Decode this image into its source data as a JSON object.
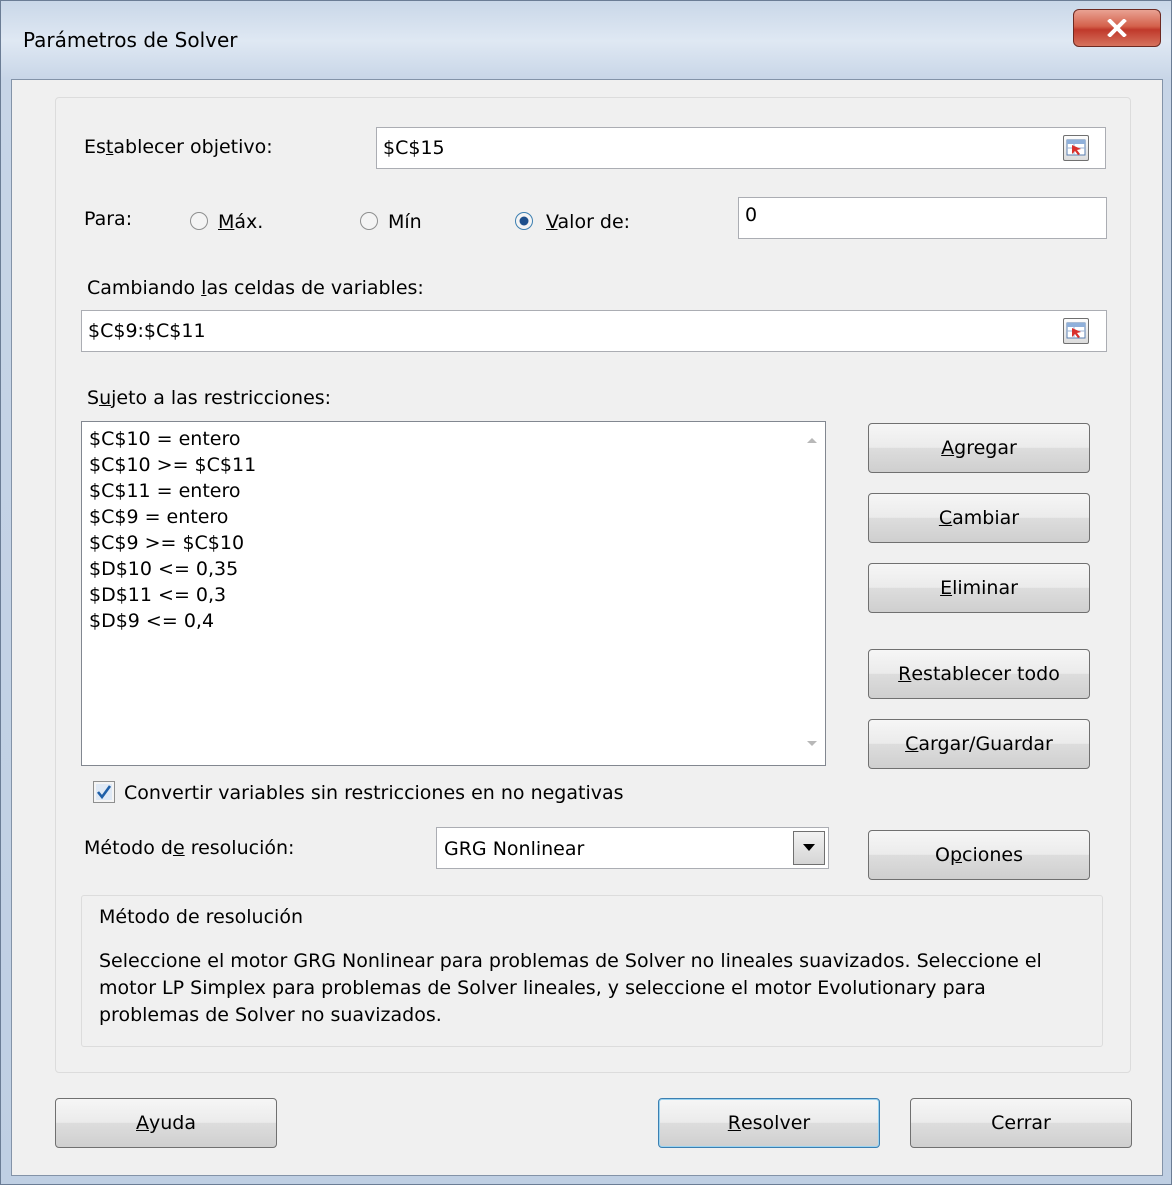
{
  "window": {
    "title": "Parámetros de Solver",
    "close_label": "X"
  },
  "objective": {
    "label_pre": "Es",
    "label_key": "t",
    "label_post": "ablecer objetivo:",
    "value": "$C$15"
  },
  "para": {
    "label": "Para:",
    "options": [
      {
        "pre": "",
        "key": "M",
        "post": "áx.",
        "selected": false
      },
      {
        "pre": "Mín",
        "key": "",
        "post": "",
        "selected": false
      },
      {
        "pre": "",
        "key": "V",
        "post": "alor de:",
        "selected": true
      }
    ],
    "value": "0"
  },
  "variables": {
    "label_pre": "Cambiando ",
    "label_key": "l",
    "label_post": "as celdas de variables:",
    "value": "$C$9:$C$11"
  },
  "constraints": {
    "label_pre": "S",
    "label_key": "u",
    "label_post": "jeto a las restricciones:",
    "items": [
      "$C$10 = entero",
      "$C$10 >= $C$11",
      "$C$11 = entero",
      "$C$9 = entero",
      "$C$9 >= $C$10",
      "$D$10 <= 0,35",
      "$D$11 <= 0,3",
      "$D$9 <= 0,4"
    ]
  },
  "side_buttons": {
    "add": {
      "key": "A",
      "rest": "gregar"
    },
    "change": {
      "key": "C",
      "rest": "ambiar"
    },
    "delete": {
      "key": "E",
      "rest": "liminar"
    },
    "reset": {
      "key": "R",
      "rest": "establecer todo"
    },
    "load": {
      "key": "C",
      "rest": "argar/Guardar"
    },
    "options": {
      "pre": "O",
      "key": "p",
      "rest": "ciones"
    }
  },
  "nonnegative": {
    "label": "Convertir variables sin restricciones en no negativas",
    "checked": true
  },
  "method": {
    "label_pre": "Método d",
    "label_key": "e",
    "label_post": " resolución:",
    "selected": "GRG Nonlinear"
  },
  "info": {
    "title": "Método de resolución",
    "body": "Seleccione el motor GRG Nonlinear para problemas de Solver no lineales suavizados. Seleccione el motor LP Simplex para problemas de Solver lineales, y seleccione el motor Evolutionary para problemas de Solver no suavizados."
  },
  "footer": {
    "help": {
      "key": "A",
      "rest": "yuda"
    },
    "solve": {
      "key": "R",
      "rest": "esolver"
    },
    "close": "Cerrar"
  },
  "colors": {
    "close_button": "#c0392b",
    "default_button_border": "#3c7fb1",
    "check": "#1e5fa8"
  }
}
